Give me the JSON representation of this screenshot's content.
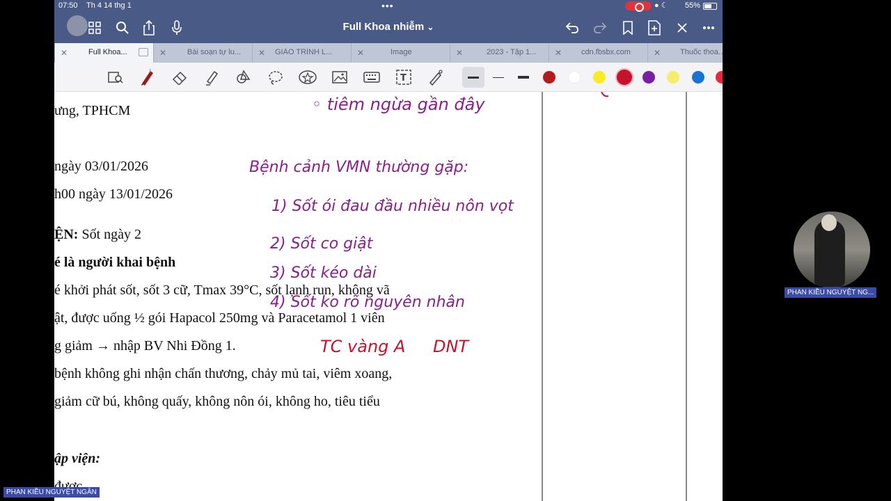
{
  "status": {
    "time": "07:50",
    "date": "Th 4 14 thg 1",
    "dots": "•••",
    "battery": "55%"
  },
  "nav": {
    "title": "Full Khoa nhiễm",
    "title_chevron": "⌄"
  },
  "tabs": [
    {
      "label": "Full Khoa..."
    },
    {
      "label": "Bài soạn tự lu..."
    },
    {
      "label": "GIÁO TRÌNH L..."
    },
    {
      "label": "Image"
    },
    {
      "label": "2023 - Tập 1..."
    },
    {
      "label": "cdn.fbsbx.com"
    },
    {
      "label": "Thuốc thoa..."
    }
  ],
  "colors": {
    "toolbar_swatches": [
      "#b51b1b",
      "#ffffff",
      "#f7ec26",
      "#c4142b",
      "#7b1fa2",
      "#f5ee6a",
      "#1a73d1",
      "#e8283b"
    ],
    "ink_purple": "#8a1f8c",
    "ink_red": "#c4142b",
    "chrome": "#4a5a86"
  },
  "document": {
    "lines": [
      {
        "text": "ưng, TPHCM"
      },
      {
        "text": " ngày 03/01/2026"
      },
      {
        "text": "h00 ngày 13/01/2026"
      },
      {
        "bold": "ỆN:",
        "text": " Sốt ngày 2"
      },
      {
        "bold": "é là người khai bệnh",
        "text": ""
      },
      {
        "text": "é khởi phát sốt, sốt 3 cữ, Tmax  39°C, sốt lạnh run, không vã"
      },
      {
        "text": "ật, được uống ½ gói Hapacol 250mg và Paracetamol 1 viên"
      },
      {
        "text": "g giảm → nhập BV Nhi Đồng 1."
      },
      {
        "text": " bệnh không ghi nhận chấn thương, chảy mủ tai, viêm xoang,"
      },
      {
        "text": "giảm cữ bú, không quấy, không nôn ói, không ho, tiêu tiểu"
      },
      {
        "bolditalic": "ập viện:",
        "text": ""
      },
      {
        "text": "được"
      }
    ]
  },
  "handwriting": {
    "vaccine": "◦ tiêm ngừa gần đây",
    "heading": "Bệnh cảnh VMN thường gặp:",
    "item1": "1) Sốt ói đau đầu nhiều nôn vọt",
    "item2": "2) Sốt co giật",
    "item3": "3) Sốt kéo dài",
    "item4": "4) Sốt ko rõ nguyên nhân",
    "tc": "TC vàng A",
    "dnt": "DNT"
  },
  "participants": {
    "webcam_name": "PHAN KIỀU NGUYỆT NG...",
    "screen_share_name": "PHAN KIỀU NGUYỆT NGÂN"
  }
}
